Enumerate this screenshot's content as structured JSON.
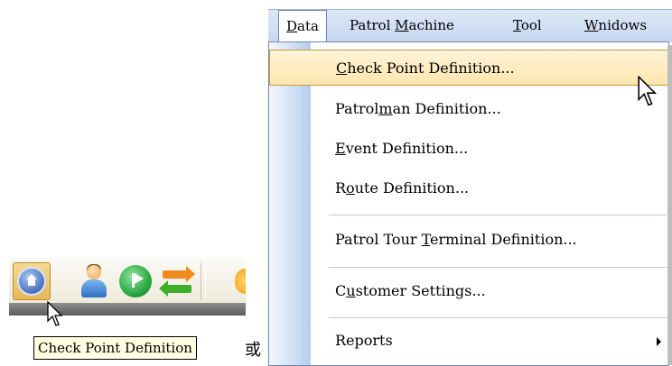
{
  "menubar": {
    "items": [
      {
        "label": "Data",
        "mnemonic": "D",
        "rest": "ata"
      },
      {
        "label": "Patrol Machine",
        "pre": "Patrol ",
        "mnemonic": "M",
        "rest": "achine"
      },
      {
        "label": "Tool",
        "mnemonic": "T",
        "rest": "ool"
      },
      {
        "label": "Wnidows",
        "mnemonic": "W",
        "rest": "nidows"
      }
    ]
  },
  "dropdown": {
    "items": [
      {
        "label": "Check Point Definition...",
        "pre": "",
        "mnemonic": "C",
        "rest": "heck Point Definition..."
      },
      {
        "label": "Patrolman Definition...",
        "pre": "Patrol",
        "mnemonic": "m",
        "rest": "an Definition..."
      },
      {
        "label": "Event Definition...",
        "pre": "",
        "mnemonic": "E",
        "rest": "vent Definition..."
      },
      {
        "label": "Route Definition...",
        "pre": "R",
        "mnemonic": "o",
        "rest": "ute Definition..."
      },
      {
        "label": "Patrol Tour Terminal Definition...",
        "pre": "Patrol Tour ",
        "mnemonic": "T",
        "rest": "erminal Definition..."
      },
      {
        "label": "Customer Settings...",
        "pre": "C",
        "mnemonic": "u",
        "rest": "stomer Settings..."
      },
      {
        "label": "Reports",
        "pre": "",
        "mnemonic": "",
        "rest": "Reports"
      }
    ]
  },
  "toolbar": {
    "buttons": [
      "home-icon",
      "patrolman-icon",
      "flag-icon",
      "swap-arrows-icon"
    ],
    "tooltip": "Check Point Definition"
  },
  "separator_text": "或",
  "colors": {
    "menubar_bg": "#c6d7ef",
    "highlight": "#fde5ad",
    "highlight_border": "#c79a3e",
    "tooltip_bg": "#ffffe1"
  }
}
